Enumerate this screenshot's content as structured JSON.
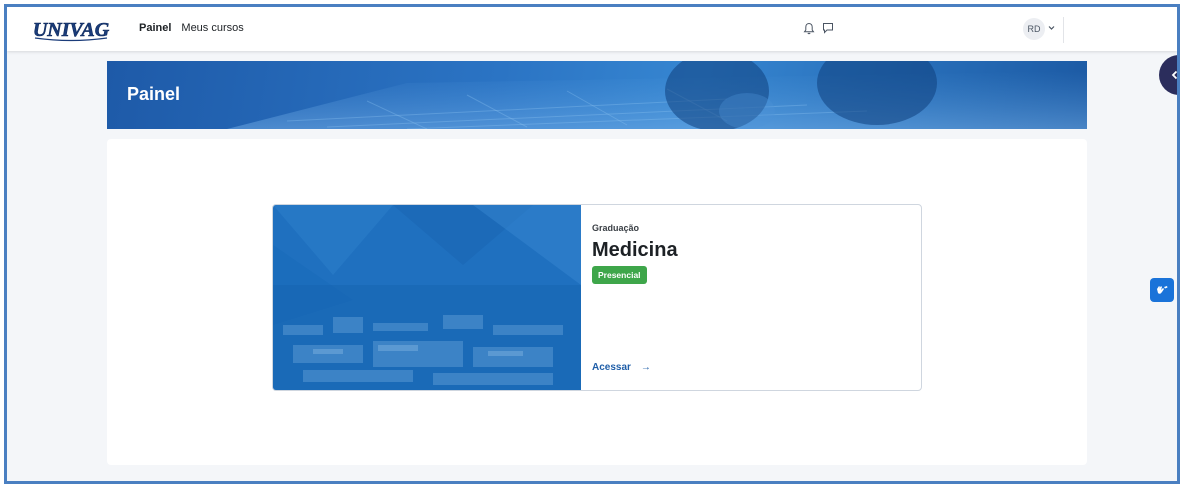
{
  "header": {
    "logo_text": "UNIVAG",
    "nav": [
      {
        "label": "Painel",
        "active": true
      },
      {
        "label": "Meus cursos",
        "active": false
      }
    ],
    "avatar_initials": "RD",
    "icons": [
      "bell-icon",
      "chat-icon",
      "chevron-down-icon"
    ]
  },
  "banner": {
    "title": "Painel"
  },
  "course_card": {
    "category": "Graduação",
    "title": "Medicina",
    "badge": "Presencial",
    "action": "Acessar",
    "arrow": "→"
  },
  "colors": {
    "brand_blue": "#1f5ea8",
    "badge_green": "#3ea64a",
    "drawer_toggle": "#2b2d5c",
    "accessibility_button": "#1a73d9"
  }
}
